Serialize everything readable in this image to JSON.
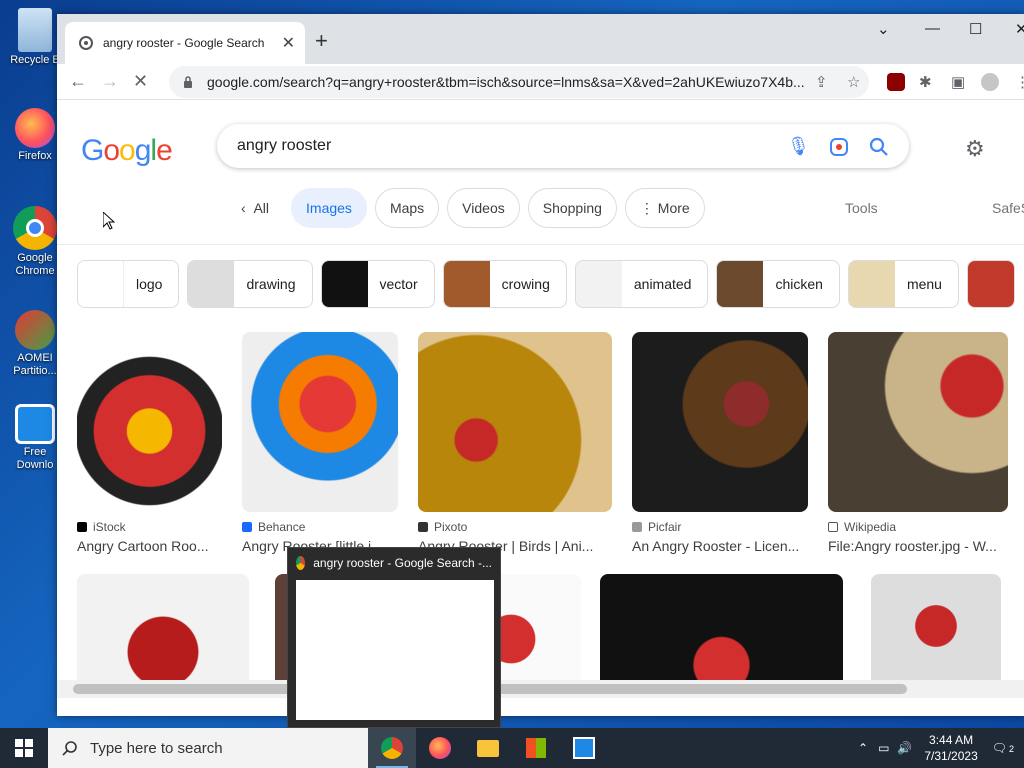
{
  "desktop": {
    "icons": [
      {
        "label": "Recycle Bin",
        "display": "Recycle B"
      },
      {
        "label": "Firefox",
        "display": "Firefox"
      },
      {
        "label": "Google Chrome",
        "display": "Google Chrome"
      },
      {
        "label": "AOMEI Partition",
        "display": "AOMEI Partitio..."
      },
      {
        "label": "Free Download",
        "display": "Free Downlo"
      }
    ]
  },
  "browser": {
    "tab_title": "angry rooster - Google Search",
    "new_tab": "+",
    "url": "google.com/search?q=angry+rooster&tbm=isch&source=lnms&sa=X&ved=2ahUKEwiuzo7X4b..."
  },
  "google": {
    "logo": "Google",
    "query": "angry rooster",
    "filters": [
      {
        "label": "All",
        "prefix": "‹"
      },
      {
        "label": "Images",
        "active": true
      },
      {
        "label": "Maps"
      },
      {
        "label": "Videos"
      },
      {
        "label": "Shopping"
      },
      {
        "label": "More",
        "prefix": "⋮"
      }
    ],
    "tools": "Tools",
    "safesearch": "SafeS",
    "chips": [
      "logo",
      "drawing",
      "vector",
      "crowing",
      "animated",
      "chicken",
      "menu"
    ],
    "results": [
      {
        "source": "iStock",
        "title": "Angry Cartoon Roo..."
      },
      {
        "source": "Behance",
        "title": "Angry Rooster [little i..."
      },
      {
        "source": "Pixoto",
        "title": "Angry Rooster | Birds | Ani..."
      },
      {
        "source": "Picfair",
        "title": "An Angry Rooster - Licen..."
      },
      {
        "source": "Wikipedia",
        "title": "File:Angry rooster.jpg - W..."
      }
    ]
  },
  "taskbar": {
    "search_placeholder": "Type here to search",
    "time": "3:44 AM",
    "date": "7/31/2023",
    "notifications": "2"
  },
  "preview": {
    "title": "angry rooster - Google Search -..."
  }
}
